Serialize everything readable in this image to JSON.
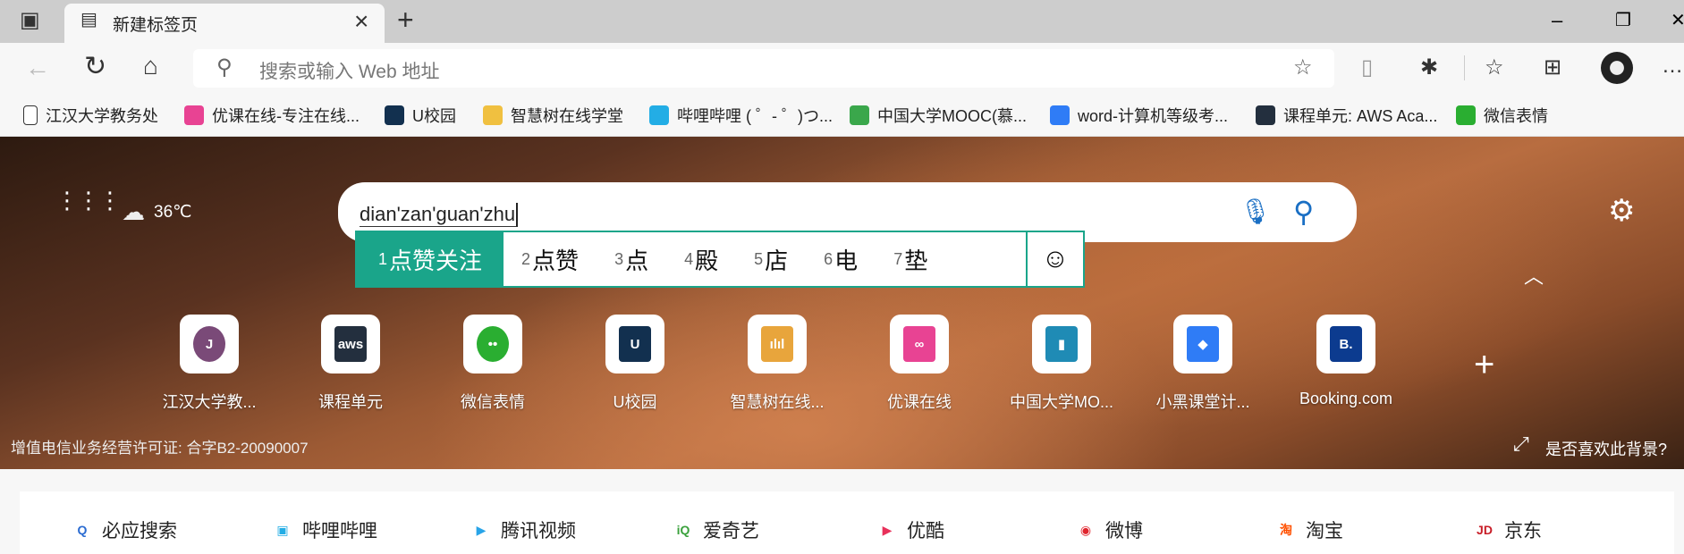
{
  "tab": {
    "title": "新建标签页",
    "close": "×",
    "new_tab": "+"
  },
  "window": {
    "minimize": "–",
    "maximize": "❐",
    "close": "✕"
  },
  "address": {
    "placeholder": "搜索或输入 Web 地址"
  },
  "bookmarks": [
    {
      "label": "江汉大学教务处",
      "color": "#ffffff"
    },
    {
      "label": "优课在线-专注在线...",
      "color": "#e84393"
    },
    {
      "label": "U校园",
      "color": "#12304f"
    },
    {
      "label": "智慧树在线学堂",
      "color": "#f0c040"
    },
    {
      "label": "哔哩哔哩 ( ゜- ゜)つ...",
      "color": "#23ade5"
    },
    {
      "label": "中国大学MOOC(慕...",
      "color": "#3aa74b"
    },
    {
      "label": "word-计算机等级考...",
      "color": "#2f7cf6"
    },
    {
      "label": "课程单元: AWS Aca...",
      "color": "#232f3e"
    },
    {
      "label": "微信表情",
      "color": "#2aae31"
    }
  ],
  "weather": {
    "temp": "36℃"
  },
  "search": {
    "value": "dian'zan'guan'zhu"
  },
  "ime": {
    "candidates": [
      {
        "n": "1",
        "t": "点赞关注"
      },
      {
        "n": "2",
        "t": "点赞"
      },
      {
        "n": "3",
        "t": "点"
      },
      {
        "n": "4",
        "t": "殿"
      },
      {
        "n": "5",
        "t": "店"
      },
      {
        "n": "6",
        "t": "电"
      },
      {
        "n": "7",
        "t": "垫"
      }
    ],
    "emoji": "☺"
  },
  "tiles": [
    {
      "label": "江汉大学教...",
      "glyph": "J",
      "color": "#7a4a78"
    },
    {
      "label": "课程单元",
      "glyph": "aws",
      "color": "#232f3e"
    },
    {
      "label": "微信表情",
      "glyph": "••",
      "color": "#2aae31"
    },
    {
      "label": "U校园",
      "glyph": "U",
      "color": "#12304f"
    },
    {
      "label": "智慧树在线...",
      "glyph": "ılıl",
      "color": "#e8a53c"
    },
    {
      "label": "优课在线",
      "glyph": "∞",
      "color": "#e84393"
    },
    {
      "label": "中国大学MO...",
      "glyph": "▮",
      "color": "#1f8bb5"
    },
    {
      "label": "小黑课堂计...",
      "glyph": "◆",
      "color": "#2f7cf6"
    },
    {
      "label": "Booking.com",
      "glyph": "B.",
      "color": "#0c3b8f"
    }
  ],
  "license": "增值电信业务经营许可证: 合字B2-20090007",
  "like_bg": "是否喜欢此背景?",
  "quicklinks": [
    {
      "label": "必应搜索",
      "glyph": "Q",
      "color": "#2a6bd1"
    },
    {
      "label": "哔哩哔哩",
      "glyph": "▣",
      "color": "#23ade5"
    },
    {
      "label": "腾讯视频",
      "glyph": "▶",
      "color": "#28a4e8"
    },
    {
      "label": "爱奇艺",
      "glyph": "iQ",
      "color": "#3aa13c"
    },
    {
      "label": "优酷",
      "glyph": "▶",
      "color": "#e8305a"
    },
    {
      "label": "微博",
      "glyph": "◉",
      "color": "#e0252d"
    },
    {
      "label": "淘宝",
      "glyph": "淘",
      "color": "#ff5000"
    },
    {
      "label": "京东",
      "glyph": "JD",
      "color": "#c81e28"
    }
  ]
}
